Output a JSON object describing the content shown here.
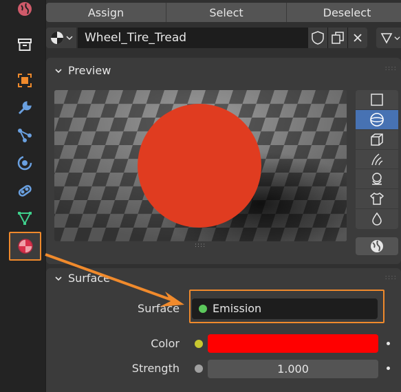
{
  "toolbar": {
    "assign": "Assign",
    "select": "Select",
    "deselect": "Deselect"
  },
  "material": {
    "name": "Wheel_Tire_Tread"
  },
  "preview": {
    "title": "Preview"
  },
  "surface": {
    "title": "Surface",
    "surface_label": "Surface",
    "surface_value": "Emission",
    "color_label": "Color",
    "strength_label": "Strength",
    "strength_value": "1.000"
  },
  "colors": {
    "accent": "#4772b3",
    "highlight": "#f08a2c",
    "emission_color": "#ff0000",
    "sphere": "#e03c20"
  },
  "icons": [
    "blender-icon",
    "box-icon",
    "focus-icon",
    "wrench-icon",
    "particles-icon",
    "physics-icon",
    "constraint-icon",
    "data-icon",
    "material-icon"
  ]
}
